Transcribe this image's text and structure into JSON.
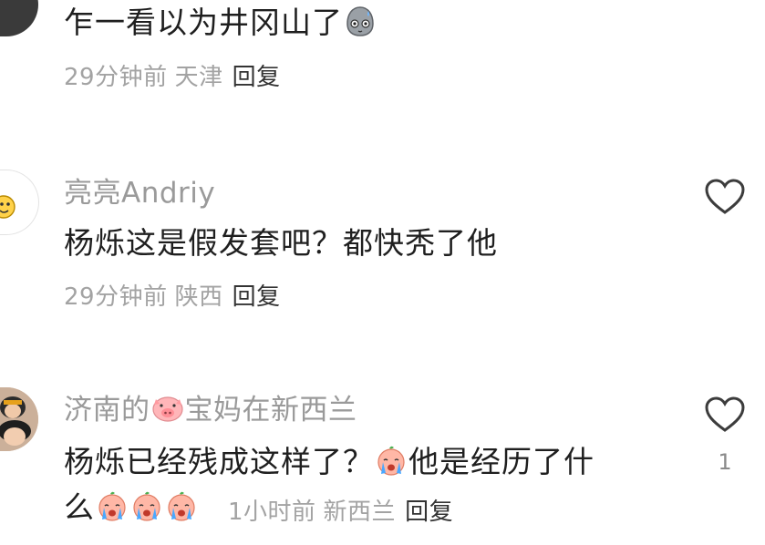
{
  "comments": [
    {
      "text": "乍一看以为井冈山了",
      "time": "29分钟前",
      "location": "天津",
      "reply_label": "回复"
    },
    {
      "username": "亮亮Andriy",
      "text": "杨烁这是假发套吧？都快秃了他",
      "time": "29分钟前",
      "location": "陕西",
      "reply_label": "回复"
    },
    {
      "username_part1": "济南的",
      "username_part2": "宝妈在新西兰",
      "text_line1_part1": "杨烁已经残成这样了？",
      "text_line1_part2": "他是经历了什",
      "text_line2": "么",
      "time": "1小时前",
      "location": "新西兰",
      "reply_label": "回复",
      "like_count": "1"
    }
  ],
  "icons": {
    "like": "heart-outline-icon",
    "emoji_sweat": "sweat-face-emoji",
    "emoji_pig": "pig-face-emoji",
    "emoji_cry": "crying-face-emoji"
  },
  "colors": {
    "username": "#9a9a9a",
    "meta": "#a3a3a3",
    "reply": "#333333",
    "text": "#1f1f1f"
  }
}
